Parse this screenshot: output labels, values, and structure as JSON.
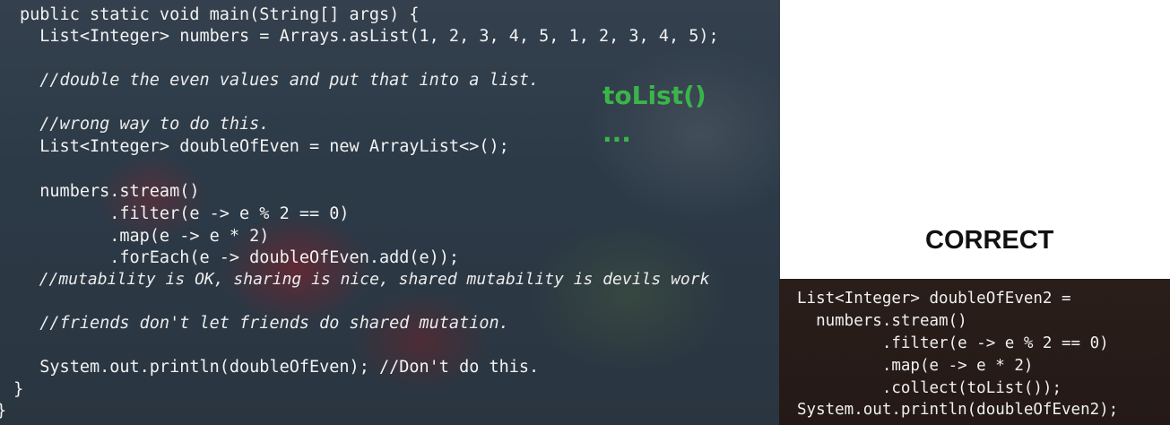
{
  "left_code": {
    "lines": [
      "public static void main(String[] args) {",
      "  List<Integer> numbers = Arrays.asList(1, 2, 3, 4, 5, 1, 2, 3, 4, 5);",
      "  //double the even values and put that into a list.",
      "  //wrong way to do this.",
      "  List<Integer> doubleOfEven = new ArrayList<>();",
      "  numbers.stream()",
      "         .filter(e -> e % 2 == 0)",
      "         .map(e -> e * 2)",
      "         .forEach(e -> doubleOfEven.add(e));",
      "  //mutability is OK, sharing is nice, shared mutability is devils work",
      "  //friends don't let friends do shared mutation.",
      "  System.out.println(doubleOfEven); //Don't do this.",
      " }",
      "}"
    ]
  },
  "annotation": {
    "text": "toList()",
    "dots": "...",
    "color": "#3bb54a"
  },
  "correct_label": "CORRECT",
  "right_code": {
    "lines": [
      "List<Integer> doubleOfEven2 =",
      "  numbers.stream()",
      "         .filter(e -> e % 2 == 0)",
      "         .map(e -> e * 2)",
      "         .collect(toList());",
      "System.out.println(doubleOfEven2);"
    ]
  }
}
